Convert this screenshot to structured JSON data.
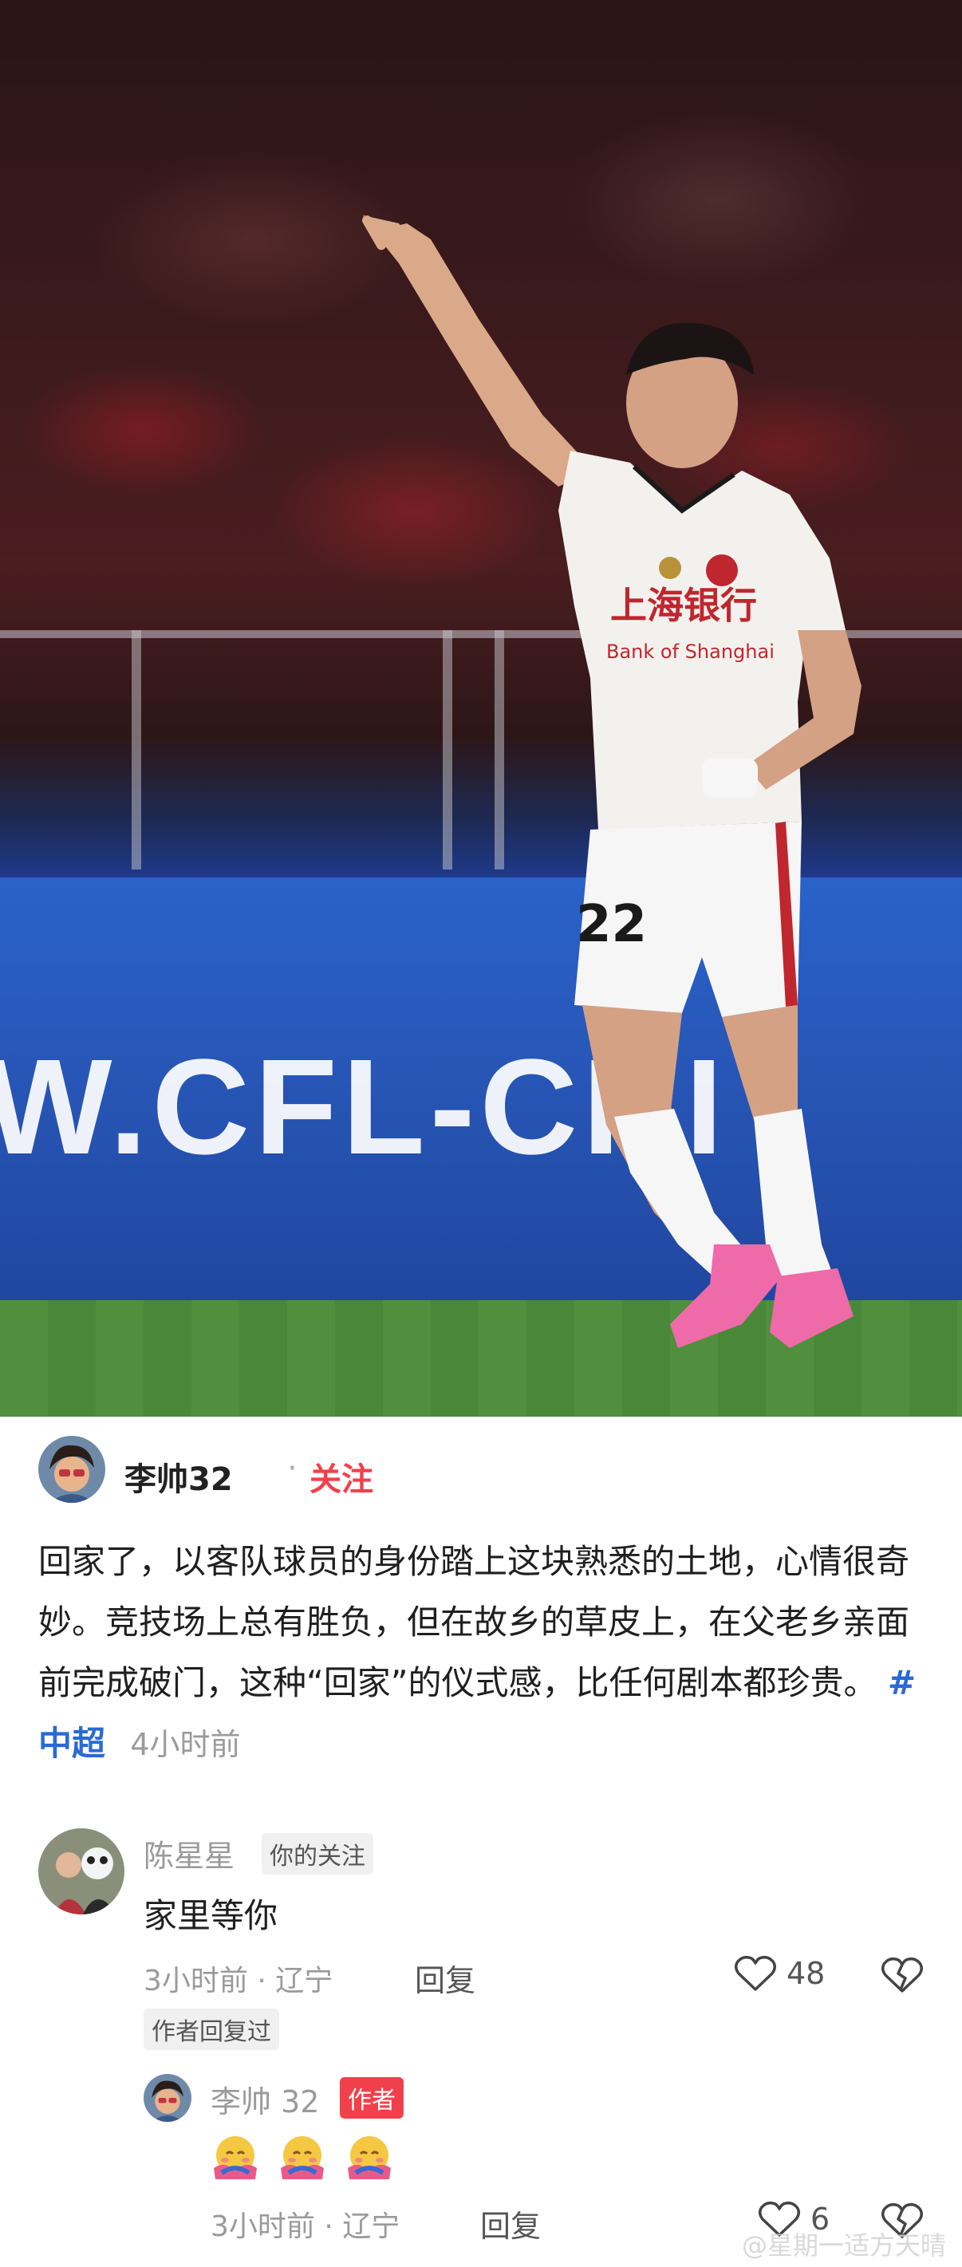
{
  "photo": {
    "board_text": "W.CFL-CHI",
    "shirt_text_cn": "上海银行",
    "shirt_text_en": "Bank of Shanghai",
    "number": "22"
  },
  "post": {
    "author": "李帅32",
    "separator": "·",
    "follow": "关注",
    "text": "回家了，以客队球员的身份踏上这块熟悉的土地，心情很奇妙。竞技场上总有胜负，但在故乡的草皮上，在父老乡亲面前完成破门，这种“回家”的仪式感，比任何剧本都珍贵。",
    "hashtag": "#中超",
    "time": "4小时前"
  },
  "comments": [
    {
      "name": "陈星星",
      "tag": "你的关注",
      "text": "家里等你",
      "meta": "3小时前 · 辽宁",
      "reply": "回复",
      "likes": "48",
      "author_replied": "作者回复过"
    }
  ],
  "reply": {
    "name": "李帅 32",
    "tag": "作者",
    "emoji_count": 3,
    "meta": "3小时前 · 辽宁",
    "reply": "回复",
    "likes": "6"
  },
  "watermark": "@星期一适方天晴",
  "colors": {
    "accent_red": "#f1404b",
    "hashtag_blue": "#2a6ad4"
  },
  "icons": [
    "heart-icon",
    "broken-heart-icon",
    "hug-emoji"
  ]
}
